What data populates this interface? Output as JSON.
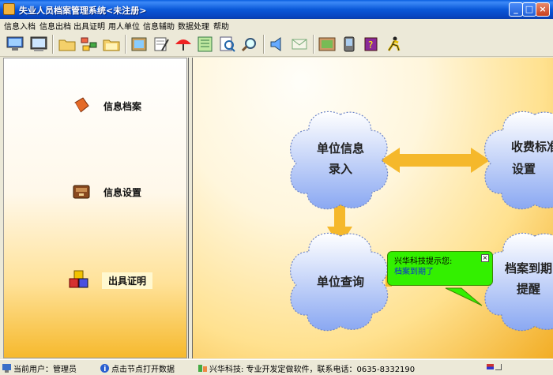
{
  "window": {
    "title": "失业人员档案管理系统<未注册>"
  },
  "menu": [
    "信息入档",
    "信息出档",
    "出具证明",
    "用人单位",
    "信息辅助",
    "数据处理",
    "帮助"
  ],
  "toolbar_icons": [
    "monitor-icon",
    "screen-icon",
    "folder-icon",
    "tree-icon",
    "open-folder-icon",
    "film-icon",
    "notes-icon",
    "umbrella-icon",
    "list-icon",
    "search-doc-icon",
    "magnifier-icon",
    "speaker-icon",
    "envelope-icon",
    "picture-icon",
    "pda-icon",
    "help-book-icon",
    "runner-icon"
  ],
  "sidebar": {
    "items": [
      {
        "label": "信息档案",
        "icon": "book-icon"
      },
      {
        "label": "信息设置",
        "icon": "cabinet-icon"
      },
      {
        "label": "出具证明",
        "icon": "cubes-icon"
      }
    ]
  },
  "flow": {
    "nodes": [
      {
        "lines": [
          "单位信息",
          "录入"
        ]
      },
      {
        "lines": [
          "收费标准",
          "设置"
        ]
      },
      {
        "lines": [
          "单位查询"
        ]
      },
      {
        "lines": [
          "档案到期",
          "提醒"
        ]
      }
    ]
  },
  "tooltip": {
    "title": "兴华科技提示您:",
    "message": "档案到期了",
    "close": "×"
  },
  "statusbar": {
    "user": "当前用户：管理员",
    "hint": "点击节点打开数据",
    "company": "兴华科技: 专业开发定做软件，联系电话：0635-8332190"
  },
  "colors": {
    "arrow": "#f5b82b",
    "cloud_top": "#ffffff",
    "cloud_bottom": "#8aa8f2",
    "tooltip": "#33f000"
  }
}
